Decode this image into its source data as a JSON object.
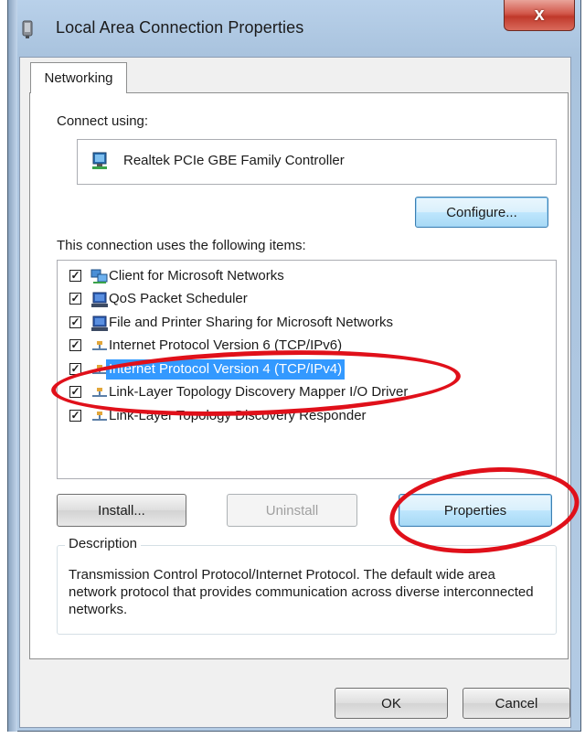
{
  "window": {
    "title": "Local Area Connection Properties",
    "close_label": "x",
    "icon": "network-adapter-icon"
  },
  "tab": {
    "label": "Networking"
  },
  "connect_using": {
    "label": "Connect using:",
    "adapter": "Realtek PCIe GBE Family Controller",
    "configure_button": "Configure..."
  },
  "items": {
    "label": "This connection uses the following items:",
    "list": [
      {
        "label": "Client for Microsoft Networks",
        "checked": true,
        "icon": "network-client-icon",
        "selected": false
      },
      {
        "label": "QoS Packet Scheduler",
        "checked": true,
        "icon": "computer-service-icon",
        "selected": false
      },
      {
        "label": "File and Printer Sharing for Microsoft Networks",
        "checked": true,
        "icon": "computer-service-icon",
        "selected": false
      },
      {
        "label": "Internet Protocol Version 6 (TCP/IPv6)",
        "checked": true,
        "icon": "protocol-icon",
        "selected": false
      },
      {
        "label": "Internet Protocol Version 4 (TCP/IPv4)",
        "checked": true,
        "icon": "protocol-icon",
        "selected": true
      },
      {
        "label": "Link-Layer Topology Discovery Mapper I/O Driver",
        "checked": true,
        "icon": "protocol-icon",
        "selected": false
      },
      {
        "label": "Link-Layer Topology Discovery Responder",
        "checked": true,
        "icon": "protocol-icon",
        "selected": false
      }
    ]
  },
  "buttons": {
    "install": "Install...",
    "uninstall": "Uninstall",
    "properties": "Properties",
    "ok": "OK",
    "cancel": "Cancel"
  },
  "description": {
    "legend": "Description",
    "text": "Transmission Control Protocol/Internet Protocol. The default wide area network protocol that provides communication across diverse interconnected networks."
  },
  "colors": {
    "annotation": "#e0101a",
    "selection": "#3399ff"
  }
}
